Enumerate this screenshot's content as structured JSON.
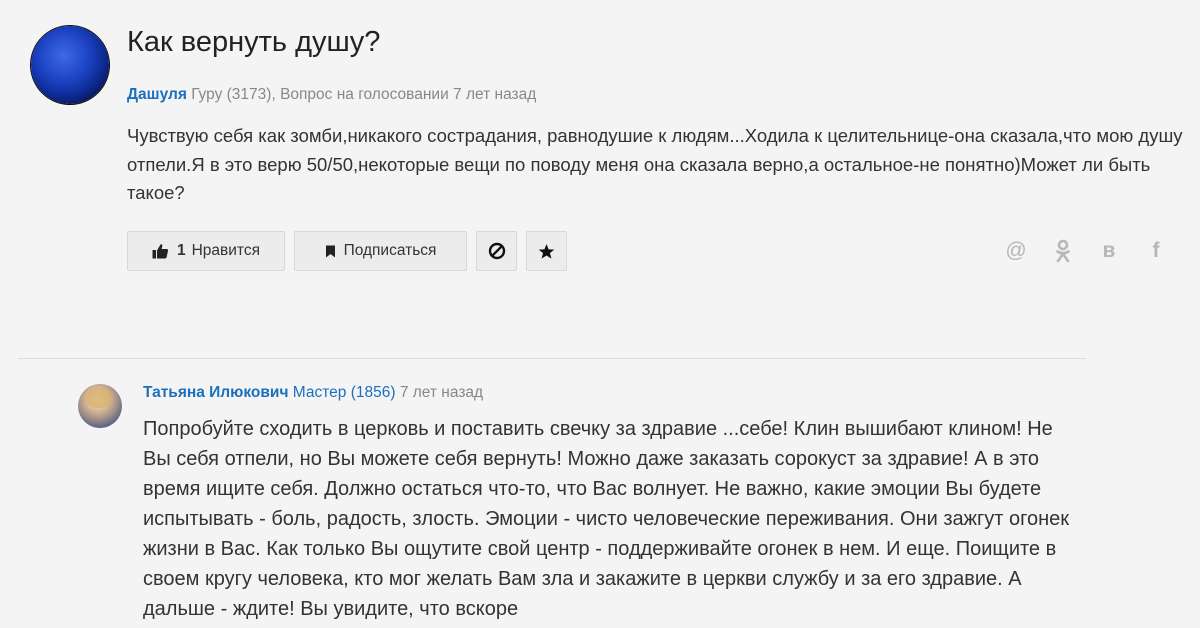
{
  "question": {
    "title": "Как вернуть душу?",
    "author": "Дашуля",
    "author_rank": "Гуру (3173),",
    "status": "Вопрос на голосовании",
    "time": "7 лет назад",
    "text": "Чувствую себя как зомби,никакого сострадания, равнодушие к людям...Ходила к целительнице-она сказала,что мою душу отпели.Я в это верю 50/50,некоторые вещи по поводу меня она сказала верно,а остальное-не понятно)Может ли быть такое?"
  },
  "actions": {
    "like_count": "1",
    "like_label": "Нравится",
    "subscribe_label": "Подписаться",
    "block_icon": "block-icon",
    "favorite_icon": "star-icon"
  },
  "share": {
    "mail_glyph": "@",
    "ok_glyph": "ok",
    "vk_glyph": "в",
    "fb_glyph": "f"
  },
  "answer": {
    "author": "Татьяна Илюкович",
    "author_rank": "Мастер (1856)",
    "time": "7 лет назад",
    "text": "Попробуйте сходить в церковь и поставить свечку за здравие ...себе! Клин вышибают клином! Не Вы себя отпели, но Вы можете себя вернуть! Можно даже заказать сорокуст за здравие! А в это время ищите себя. Должно остаться что-то, что Вас волнует. Не важно, какие эмоции Вы будете испытывать - боль, радость, злость. Эмоции - чисто человеческие переживания. Они зажгут огонек жизни в Вас. Как только Вы ощутите свой центр - поддерживайте огонек в нем. И еще. Поищите в своем кругу человека, кто мог желать Вам зла и закажите в церкви службу и за его здравие. А дальше - ждите! Вы увидите, что вскоре"
  },
  "colors": {
    "link": "#1a6fbf",
    "background": "#f4f4f4",
    "button": "#ececec",
    "share_icon": "#b7b7b7"
  }
}
